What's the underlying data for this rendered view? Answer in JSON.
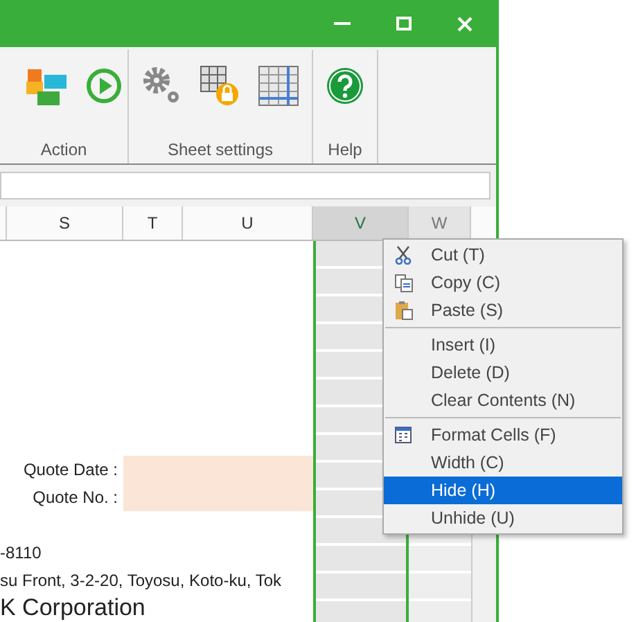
{
  "ribbon": {
    "groups": [
      {
        "kind": "action",
        "label": "Action"
      },
      {
        "kind": "sheet",
        "label": "Sheet settings"
      },
      {
        "kind": "help",
        "label": "Help"
      }
    ]
  },
  "columns": [
    {
      "label": "S",
      "selected": false
    },
    {
      "label": "T",
      "selected": false
    },
    {
      "label": "U",
      "selected": false
    },
    {
      "label": "V",
      "selected": true
    },
    {
      "label": "W",
      "selected": false
    }
  ],
  "fields": [
    {
      "label": "Quote Date :"
    },
    {
      "label": "Quote No. :"
    }
  ],
  "address_lines": [
    "-8110",
    "su Front, 3-2-20, Toyosu, Koto-ku, Tok",
    "K Corporation"
  ],
  "context_menu": {
    "sections": [
      [
        {
          "kind": "cut",
          "label": "Cut (T)",
          "selected": false
        },
        {
          "kind": "copy",
          "label": "Copy (C)",
          "selected": false
        },
        {
          "kind": "paste",
          "label": "Paste (S)",
          "selected": false
        }
      ],
      [
        {
          "kind": "plain",
          "label": "Insert (I)",
          "selected": false
        },
        {
          "kind": "plain",
          "label": "Delete (D)",
          "selected": false
        },
        {
          "kind": "plain",
          "label": "Clear Contents (N)",
          "selected": false
        }
      ],
      [
        {
          "kind": "format",
          "label": "Format Cells (F)",
          "selected": false
        },
        {
          "kind": "plain",
          "label": "Width (C)",
          "selected": false
        },
        {
          "kind": "plain",
          "label": "Hide (H)",
          "selected": true
        },
        {
          "kind": "plain",
          "label": "Unhide (U)",
          "selected": false
        }
      ]
    ]
  }
}
